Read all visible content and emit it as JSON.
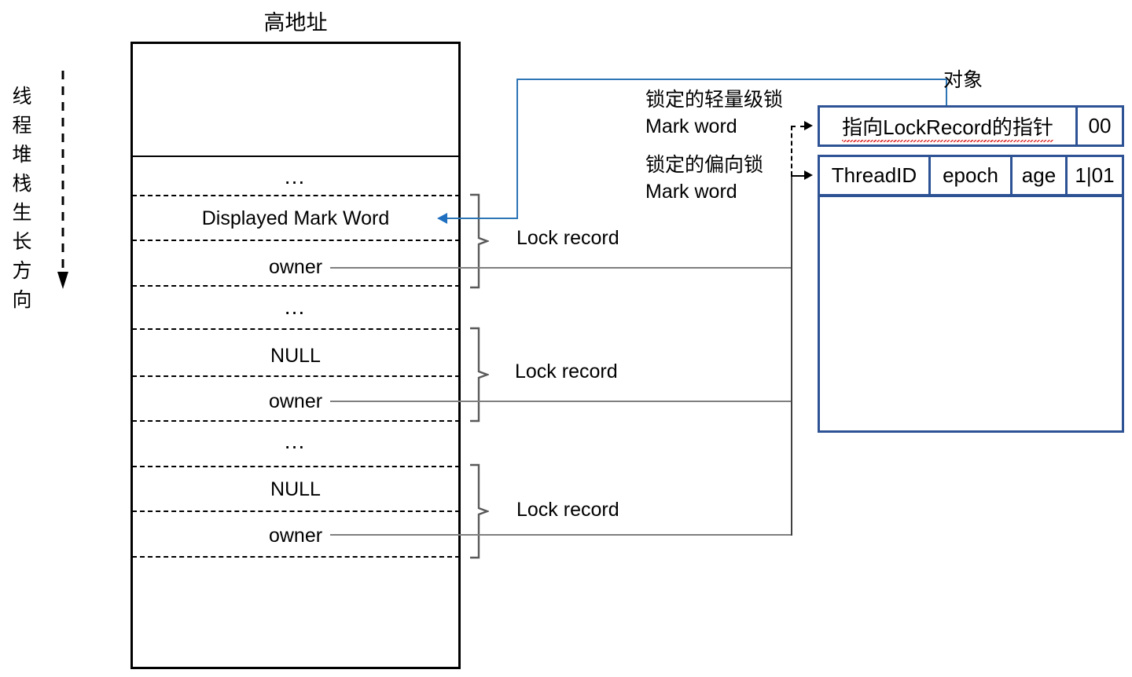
{
  "diagram": {
    "title_top": "高地址",
    "growth_label": [
      "线",
      "程",
      "堆",
      "栈",
      "生",
      "长",
      "方",
      "向"
    ],
    "growth_label_text": "线程堆栈生长方向",
    "stack_rows": [
      {
        "id": "blank-top",
        "text": ""
      },
      {
        "id": "ellipsis-1",
        "text": "…"
      },
      {
        "id": "displayed-mark-word",
        "text": "Displayed Mark Word"
      },
      {
        "id": "owner-1",
        "text": "owner"
      },
      {
        "id": "ellipsis-2",
        "text": "…"
      },
      {
        "id": "null-1",
        "text": "NULL"
      },
      {
        "id": "owner-2",
        "text": "owner"
      },
      {
        "id": "ellipsis-3",
        "text": "…"
      },
      {
        "id": "null-2",
        "text": "NULL"
      },
      {
        "id": "owner-3",
        "text": "owner"
      },
      {
        "id": "blank-bottom",
        "text": ""
      }
    ],
    "lock_record_labels": [
      "Lock record",
      "Lock record",
      "Lock record"
    ],
    "annotations": {
      "lightweight_lock": "锁定的轻量级锁\nMark word",
      "biased_lock": "锁定的偏向锁\nMark word",
      "object": "对象"
    },
    "mark_word_lightweight": {
      "fields": [
        {
          "label": "指向LockRecord的指针",
          "spell_error_part": "LockRecord"
        },
        {
          "label": "00"
        }
      ]
    },
    "mark_word_biased": {
      "fields": [
        {
          "label": "ThreadID"
        },
        {
          "label": "epoch"
        },
        {
          "label": "age"
        },
        {
          "label": "1|01"
        }
      ]
    },
    "colors": {
      "box_border": "#2E5395",
      "connector_blue": "#2E75B6",
      "owner_line": "#7F7F7F",
      "brace": "#595959",
      "stack_border": "#000000"
    }
  }
}
